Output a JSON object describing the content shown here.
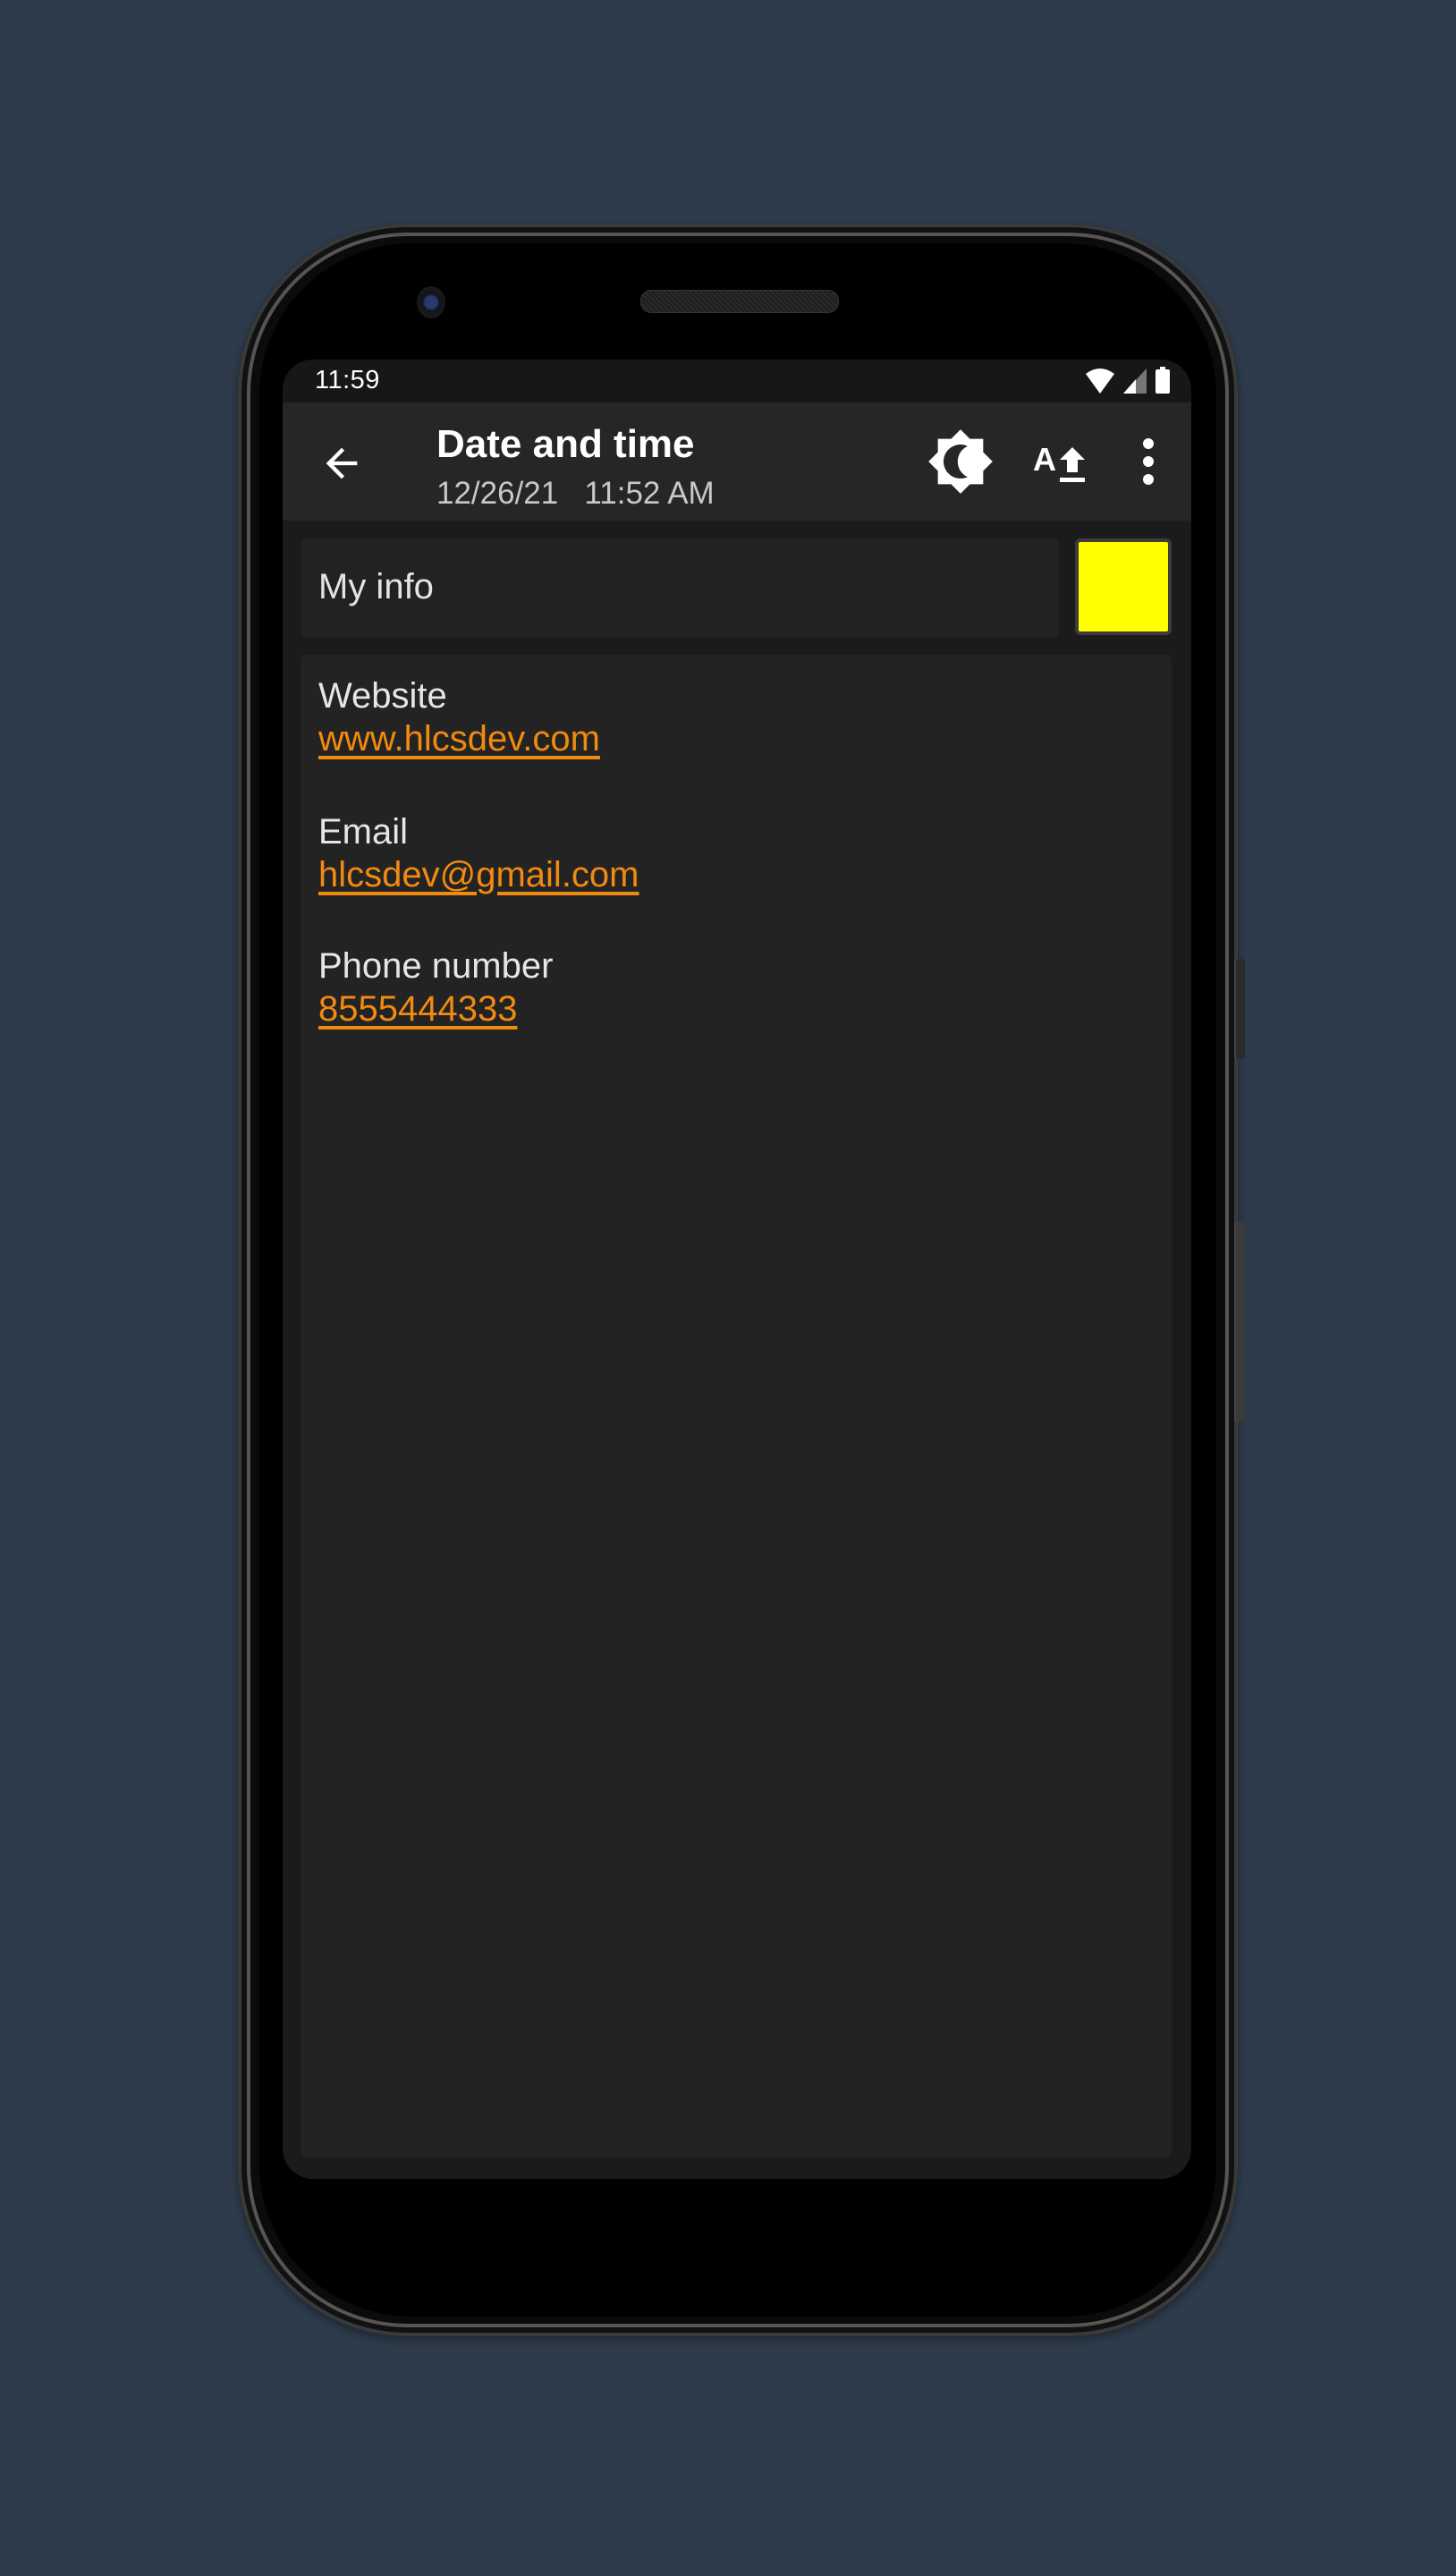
{
  "status_bar": {
    "time": "11:59",
    "icons": [
      "wifi-icon",
      "cellular-signal-icon",
      "battery-icon"
    ]
  },
  "app_bar": {
    "title": "Date and time",
    "subtitle": "12/26/21   11:52 AM",
    "back_icon": "arrow-back-icon",
    "actions": [
      {
        "name": "theme-toggle",
        "icon": "brightness-contrast-icon"
      },
      {
        "name": "font-size",
        "icon": "text-increase-icon"
      },
      {
        "name": "more-options",
        "icon": "more-vert-icon"
      }
    ]
  },
  "my_info": {
    "label": "My info",
    "color_swatch": "#ffff00"
  },
  "fields": [
    {
      "label": "Website",
      "value": "www.hlcsdev.com"
    },
    {
      "label": "Email",
      "value": "hlcsdev@gmail.com"
    },
    {
      "label": "Phone number",
      "value": "8555444333"
    }
  ],
  "colors": {
    "link": "#f18a10",
    "background": "#2d3b4b",
    "app_bar": "#262626",
    "card": "#232323"
  }
}
